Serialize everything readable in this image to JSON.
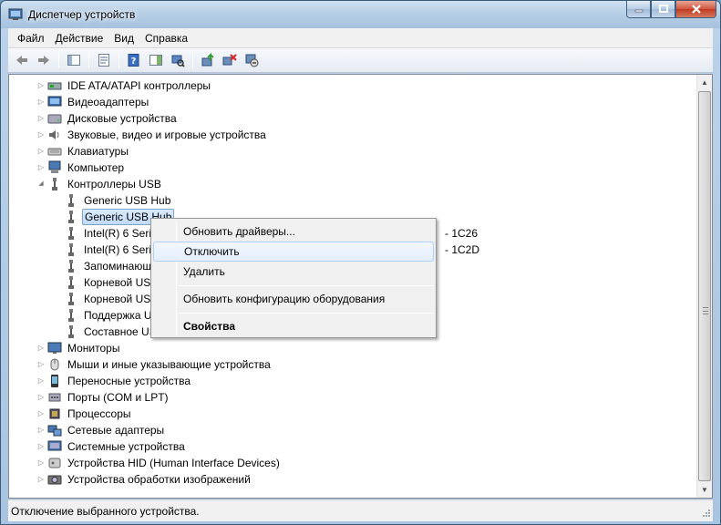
{
  "window": {
    "title": "Диспетчер устройств"
  },
  "menu": [
    "Файл",
    "Действие",
    "Вид",
    "Справка"
  ],
  "tree": {
    "items": [
      {
        "label": "IDE ATA/ATAPI контроллеры",
        "icon": "ide-controller-icon"
      },
      {
        "label": "Видеоадаптеры",
        "icon": "display-adapter-icon"
      },
      {
        "label": "Дисковые устройства",
        "icon": "disk-drive-icon"
      },
      {
        "label": "Звуковые, видео и игровые устройства",
        "icon": "sound-icon"
      },
      {
        "label": "Клавиатуры",
        "icon": "keyboard-icon"
      },
      {
        "label": "Компьютер",
        "icon": "computer-icon"
      },
      {
        "label": "Контроллеры USB",
        "icon": "usb-icon",
        "expanded": true
      },
      {
        "label": "Generic USB Hub",
        "icon": "usb-icon",
        "child": true
      },
      {
        "label": "Generic USB Hub",
        "icon": "usb-icon",
        "child": true,
        "selected": true
      },
      {
        "label": "Intel(R) 6 Series",
        "suffix": "- 1C26",
        "icon": "usb-icon",
        "child": true
      },
      {
        "label": "Intel(R) 6 Series",
        "suffix": "- 1C2D",
        "icon": "usb-icon",
        "child": true
      },
      {
        "label": "Запоминающ",
        "icon": "usb-icon",
        "child": true
      },
      {
        "label": "Корневой USB",
        "icon": "usb-icon",
        "child": true
      },
      {
        "label": "Корневой USB",
        "icon": "usb-icon",
        "child": true
      },
      {
        "label": "Поддержка U",
        "icon": "usb-icon",
        "child": true
      },
      {
        "label": "Составное US",
        "icon": "usb-icon",
        "child": true
      },
      {
        "label": "Мониторы",
        "icon": "monitor-icon"
      },
      {
        "label": "Мыши и иные указывающие устройства",
        "icon": "mouse-icon"
      },
      {
        "label": "Переносные устройства",
        "icon": "portable-device-icon"
      },
      {
        "label": "Порты (COM и LPT)",
        "icon": "port-icon"
      },
      {
        "label": "Процессоры",
        "icon": "processor-icon"
      },
      {
        "label": "Сетевые адаптеры",
        "icon": "network-adapter-icon"
      },
      {
        "label": "Системные устройства",
        "icon": "system-device-icon"
      },
      {
        "label": "Устройства HID (Human Interface Devices)",
        "icon": "hid-icon"
      },
      {
        "label": "Устройства обработки изображений",
        "icon": "imaging-device-icon"
      }
    ]
  },
  "context_menu": {
    "update_drivers": "Обновить драйверы...",
    "disable": "Отключить",
    "uninstall": "Удалить",
    "scan_hardware": "Обновить конфигурацию оборудования",
    "properties": "Свойства"
  },
  "status": {
    "text": "Отключение выбранного устройства."
  },
  "colors": {
    "selection": "#c1dbfc",
    "titlebar": "#b5cde6",
    "close": "#c03a20"
  }
}
